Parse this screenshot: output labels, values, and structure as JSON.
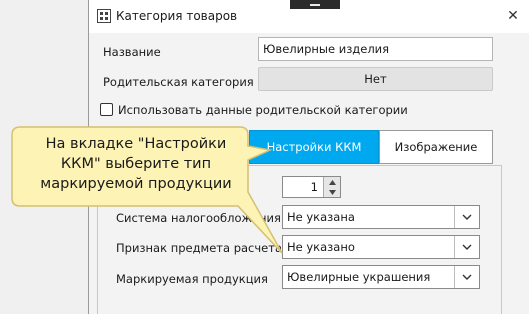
{
  "window": {
    "title": "Категория товаров",
    "close_glyph": "✕"
  },
  "form": {
    "name_label": "Название",
    "name_value": "Ювелирные изделия",
    "parent_label": "Родительская категория",
    "parent_button": "Нет",
    "use_parent_label": "Использовать данные родительской категории",
    "use_parent_checked": false
  },
  "tabs": [
    {
      "label": "Настройки ККМ",
      "active": true
    },
    {
      "label": "Изображение",
      "active": false
    }
  ],
  "kkm": {
    "spin_value": "1",
    "tax_label": "Система налогообложения",
    "tax_value": "Не указана",
    "subject_label": "Признак предмета расчета",
    "subject_value": "Не указано",
    "marking_label": "Маркируемая продукция",
    "marking_value": "Ювелирные украшения"
  },
  "callout": {
    "lines": [
      "На вкладке \"Настройки",
      "ККМ\" выберите тип",
      "маркируемой продукции"
    ],
    "fill": "#fdf3b5",
    "stroke": "#d4c070"
  },
  "colors": {
    "accent": "#00a8f0"
  }
}
